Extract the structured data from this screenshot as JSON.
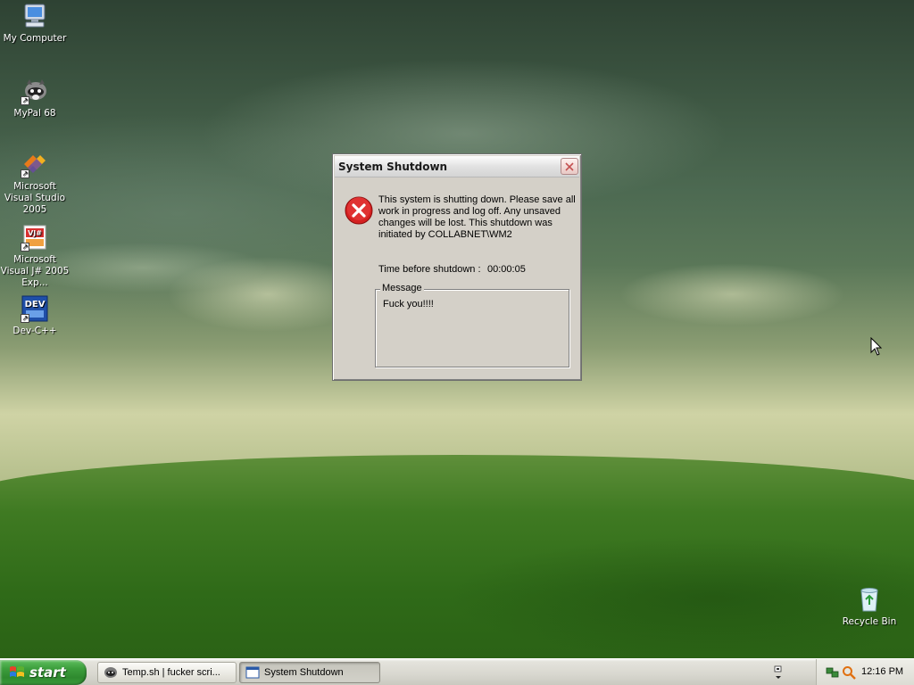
{
  "desktop": {
    "icons": [
      {
        "label": "My Computer"
      },
      {
        "label": "MyPal 68"
      },
      {
        "label": "Microsoft Visual Studio 2005"
      },
      {
        "label": "Microsoft Visual J# 2005 Exp..."
      },
      {
        "label": "Dev-C++"
      },
      {
        "label": "Recycle Bin"
      }
    ]
  },
  "dialog": {
    "title": "System Shutdown",
    "message": "This system is shutting down. Please save all work in progress and log off. Any unsaved changes will be lost. This shutdown was initiated by COLLABNET\\WM2",
    "timer_label": "Time before shutdown :",
    "timer_value": "00:00:05",
    "group_label": "Message",
    "group_content": "Fuck you!!!!"
  },
  "taskbar": {
    "start_label": "start",
    "tasks": [
      {
        "label": "Temp.sh | fucker scri..."
      },
      {
        "label": "System Shutdown"
      }
    ],
    "clock": "12:16 PM"
  },
  "icons": {
    "error": "error-x-icon",
    "close": "close-icon",
    "brand_start": "windows-logo-icon"
  },
  "colors": {
    "dialog_bg": "#d4d0c8",
    "start_green": "#3c9e3c",
    "error_red": "#d42020"
  }
}
